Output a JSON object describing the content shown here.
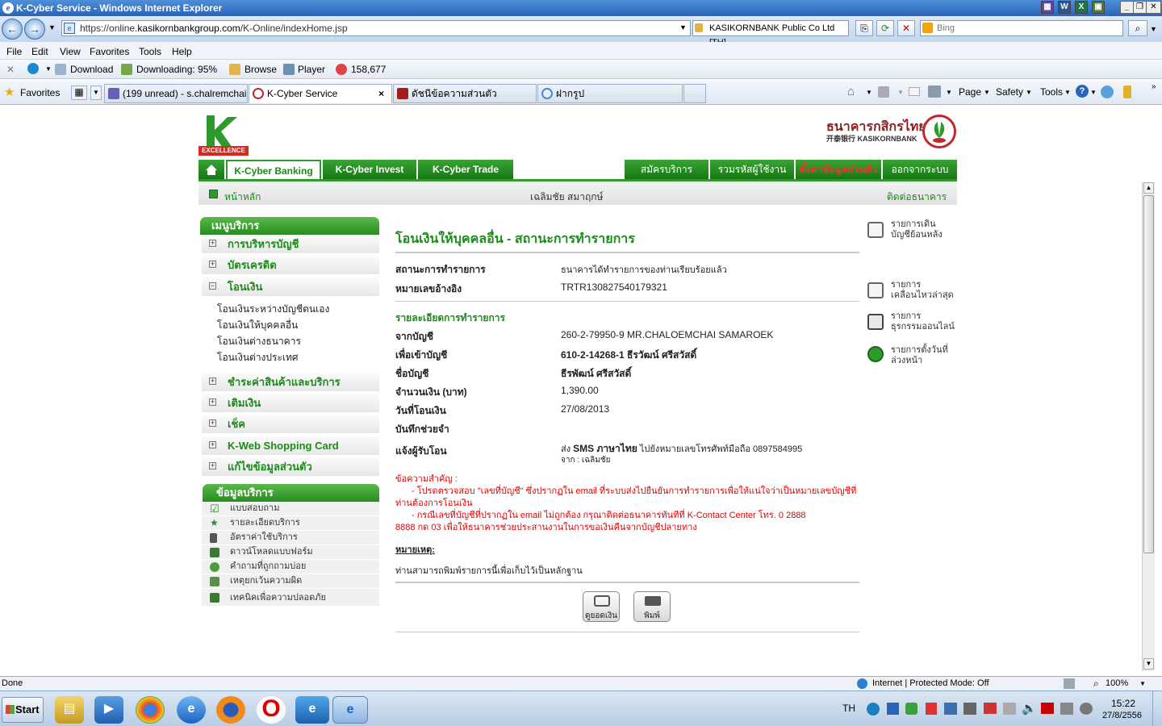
{
  "window": {
    "title": "K-Cyber Service - Windows Internet Explorer"
  },
  "address": {
    "url_prefix": "https://online.",
    "url_host": "kasikornbankgroup.com",
    "url_path": "/K-Online/indexHome.jsp",
    "cert": "KASIKORNBANK Public Co Ltd [TH]",
    "search_placeholder": "Bing"
  },
  "menu": {
    "file": "File",
    "edit": "Edit",
    "view": "View",
    "favorites": "Favorites",
    "tools": "Tools",
    "help": "Help"
  },
  "toolbar2": {
    "download": "Download",
    "downloading": "Downloading: 95%",
    "browse": "Browse",
    "player": "Player",
    "count": "158,677"
  },
  "favbar": {
    "favorites": "Favorites",
    "tabs": [
      "(199 unread) - s.chalremchai...",
      "K-Cyber Service",
      "ดัชนีข้อความส่วนตัว",
      "ฝากรูป"
    ],
    "tab_close": "×",
    "page": "Page",
    "safety": "Safety",
    "tools": "Tools"
  },
  "bank": {
    "logo_word": "EXCELLENCE",
    "bank_name": "ธนาคารกสิกรไทย",
    "bank_sub": "开泰银行 KASIKORNBANK",
    "nav": {
      "k_cyber_banking": "K-Cyber Banking",
      "k_cyber_invest": "K-Cyber Invest",
      "k_cyber_trade": "K-Cyber Trade",
      "register": "สมัครบริการ",
      "combine_id": "รวมรหัสผู้ใช้งาน",
      "settings": "ตั้งค่าข้อมูลส่วนตัว",
      "logout": "ออกจากระบบ"
    },
    "bar": {
      "home": "หน้าหลัก",
      "user": "เฉลิมชัย สมาฤกษ์",
      "contact": "ติดต่อธนาคาร"
    },
    "service_menu": {
      "title": "เมนูบริการ",
      "items": [
        "การบริหารบัญชี",
        "บัตรเครดิต",
        "โอนเงิน",
        "ชำระค่าสินค้าและบริการ",
        "เติมเงิน",
        "เช็ค",
        "K-Web Shopping Card",
        "แก้ไขข้อมูลส่วนตัว"
      ],
      "transfer_sub": [
        "โอนเงินระหว่างบัญชีตนเอง",
        "โอนเงินให้บุคคลอื่น",
        "โอนเงินต่างธนาคาร",
        "โอนเงินต่างประเทศ"
      ],
      "plus": "+",
      "minus": "−"
    },
    "info_menu": {
      "title": "ข้อมูลบริการ",
      "items": [
        "แบบสอบถาม",
        "รายละเอียดบริการ",
        "อัตราค่าใช้บริการ",
        "ดาวน์โหลดแบบฟอร์ม",
        "คำถามที่ถูกถามบ่อย",
        "เหตุยกเว้นความผิด",
        "เทคนิคเพื่อความปลอดภัย"
      ]
    },
    "main": {
      "title": "โอนเงินให้บุคคลอื่น - สถานะการทำรายการ",
      "status_label": "สถานะการทำรายการ",
      "status_value": "ธนาคารได้ทำรายการของท่านเรียบร้อยแล้ว",
      "ref_label": "หมายเลขอ้างอิง",
      "ref_value": "TRTR130827540179321",
      "details_head": "รายละเอียดการทำรายการ",
      "from_label": "จากบัญชี",
      "from_value": "260-2-79950-9 MR.CHALOEMCHAI SAMAROEK",
      "to_label": "เพื่อเข้าบัญชี",
      "to_value": "610-2-14268-1 ธีรวัฒน์ ศรีสวัสดิ์",
      "name_label": "ชื่อบัญชี",
      "name_value": "ธีรพัฒน์ ศรีสวัสดิ์",
      "amount_label": "จำนวนเงิน (บาท)",
      "amount_value": "1,390.00",
      "date_label": "วันที่โอนเงิน",
      "date_value": "27/08/2013",
      "memo_label": "บันทึกช่วยจำ",
      "notify_label": "แจ้งผู้รับโอน",
      "notify_prefix": "ส่ง",
      "notify_sms": "SMS ภาษาไทย",
      "notify_suffix": "ไปยังหมายเลขโทรศัพท์มือถือ  0897584995",
      "notify_from": "จาก   : เฉลิมชัย",
      "important_head": "ข้อความสำคัญ  :",
      "important_1a": "- โปรดตรวจสอบ  \"เลขที่บัญชี\" ซึ่งปรากฏใน  email ที่ระบบส่งไปยืนยันการทำรายการเพื่อให้แน่ใจว่าเป็นหมายเลขบัญชีที่",
      "important_1b": "ท่านต้องการโอนเงิน",
      "important_2a": "- กรณีเลขที่บัญชีที่ปรากฏใน  email ไม่ถูกต้อง  กรุณาติดต่อธนาคารทันทีที่  K-Contact Center โทร. 0 2888",
      "important_2b": "8888 กด  03 เพื่อให้ธนาคารช่วยประสานงานในการขอเงินคืนจากบัญชีปลายทาง",
      "note_head": "หมายเหตุ:",
      "note_text": "ท่านสามารถพิมพ์รายการนี้เพื่อเก็บไว้เป็นหลักฐาน",
      "btn_balance": "ดูยอดเงิน",
      "btn_print": "พิมพ์"
    },
    "right_links": [
      {
        "l1": "รายการเดิน",
        "l2": "บัญชีย้อนหลัง"
      },
      {
        "l1": "รายการ",
        "l2": "เคลื่อนไหวล่าสุด"
      },
      {
        "l1": "รายการ",
        "l2": "ธุรกรรมออนไลน์"
      },
      {
        "l1": "รายการตั้งวันที่",
        "l2": "ล่วงหน้า"
      }
    ]
  },
  "status": {
    "left": "Done",
    "zone": "Internet | Protected Mode: Off",
    "zoom": "100%"
  },
  "taskbar": {
    "start": "Start",
    "lang": "TH",
    "time": "15:22",
    "date": "27/8/2556"
  }
}
